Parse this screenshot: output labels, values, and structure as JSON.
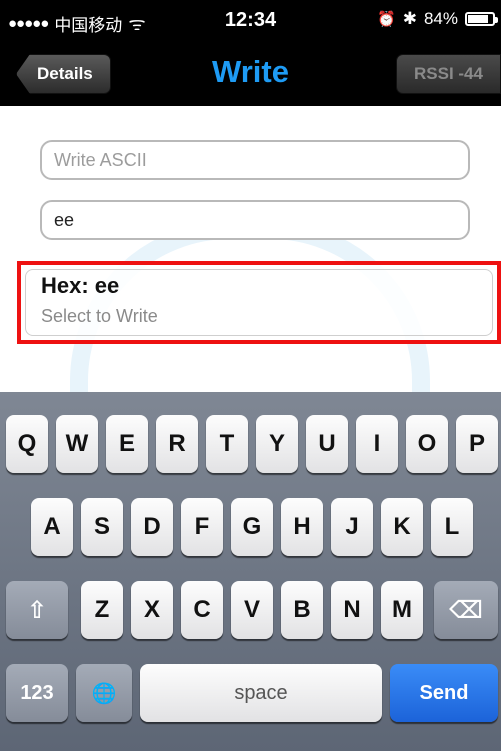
{
  "status_bar": {
    "signal": "●●●●●",
    "carrier": "中国移动",
    "wifi": "ᯤ",
    "time": "12:34",
    "alarm": "⏰",
    "bluetooth": "✱",
    "battery_percent": "84%",
    "battery_level": 0.84
  },
  "nav": {
    "back_label": "Details",
    "title": "Write",
    "rssi_label": "RSSI -44"
  },
  "form": {
    "ascii_placeholder": "Write ASCII",
    "ascii_value": "",
    "hex_value": "ee"
  },
  "hex_cell": {
    "title": "Hex: ee",
    "subtitle": "Select to Write"
  },
  "keyboard": {
    "row1": [
      "Q",
      "W",
      "E",
      "R",
      "T",
      "Y",
      "U",
      "I",
      "O",
      "P"
    ],
    "row2": [
      "A",
      "S",
      "D",
      "F",
      "G",
      "H",
      "J",
      "K",
      "L"
    ],
    "row3": [
      "Z",
      "X",
      "C",
      "V",
      "B",
      "N",
      "M"
    ],
    "shift": "⇧",
    "delete": "⌫",
    "numbers": "123",
    "globe": "🌐",
    "space": "space",
    "send": "Send"
  },
  "colors": {
    "accent": "#1e9bf4",
    "highlight_border": "#ee1111",
    "send_key": "#1c63d9"
  }
}
